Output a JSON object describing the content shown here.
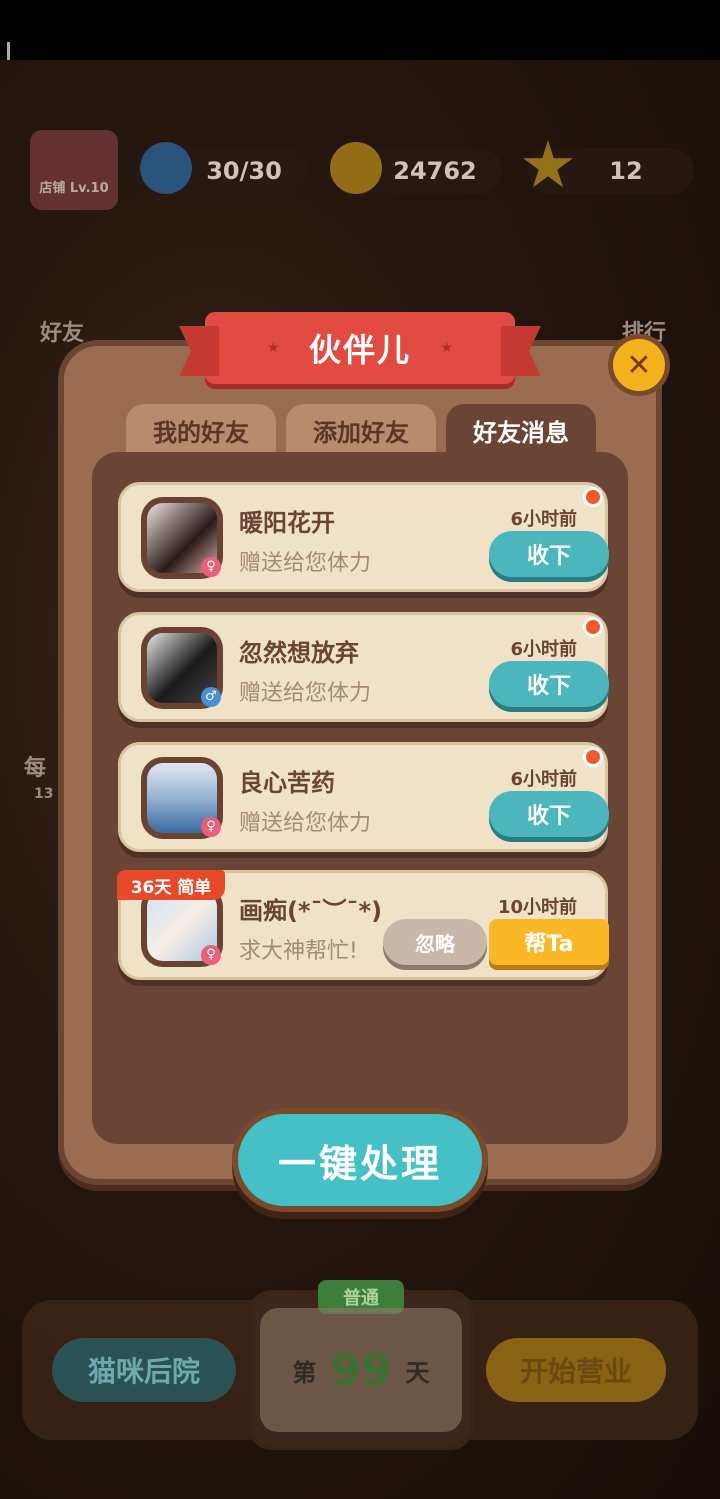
{
  "top_bar": {
    "shop_label": "店铺 Lv.10",
    "energy": "30/30",
    "coins": "24762",
    "stars": "12"
  },
  "side": {
    "friends_label": "好友",
    "ranking_label": "排行",
    "daily_label": "每",
    "daily_sub": "13"
  },
  "dialog": {
    "title": "伙伴儿",
    "close_icon": "close-icon",
    "tabs": [
      {
        "label": "我的好友",
        "active": false
      },
      {
        "label": "添加好友",
        "active": false
      },
      {
        "label": "好友消息",
        "active": true
      }
    ],
    "messages": [
      {
        "name": "暖阳花开",
        "text": "赠送给您体力",
        "time": "6小时前",
        "gender": "♀",
        "action": "收下",
        "unread": true
      },
      {
        "name": "忽然想放弃",
        "text": "赠送给您体力",
        "time": "6小时前",
        "gender": "♂",
        "action": "收下",
        "unread": true
      },
      {
        "name": "良心苦药",
        "text": "赠送给您体力",
        "time": "6小时前",
        "gender": "♀",
        "action": "收下",
        "unread": true
      },
      {
        "name": "画痴(*¯︶¯*)",
        "text": "求大神帮忙!",
        "time": "10小时前",
        "gender": "♀",
        "badge": "36天 简单",
        "ignore": "忽略",
        "help": "帮Ta"
      }
    ],
    "main_button": "一键处理"
  },
  "bottom": {
    "backyard": "猫咪后院",
    "mode_tag": "普通",
    "day_prefix": "第",
    "day_number": "99",
    "day_suffix": "天",
    "start": "开始营业"
  },
  "colors": {
    "ribbon": "#e24b41",
    "accept": "#4bb7bd",
    "help": "#fbb826",
    "badge": "#e8492b",
    "card": "#efe2c6",
    "panel": "#9a6c52"
  }
}
